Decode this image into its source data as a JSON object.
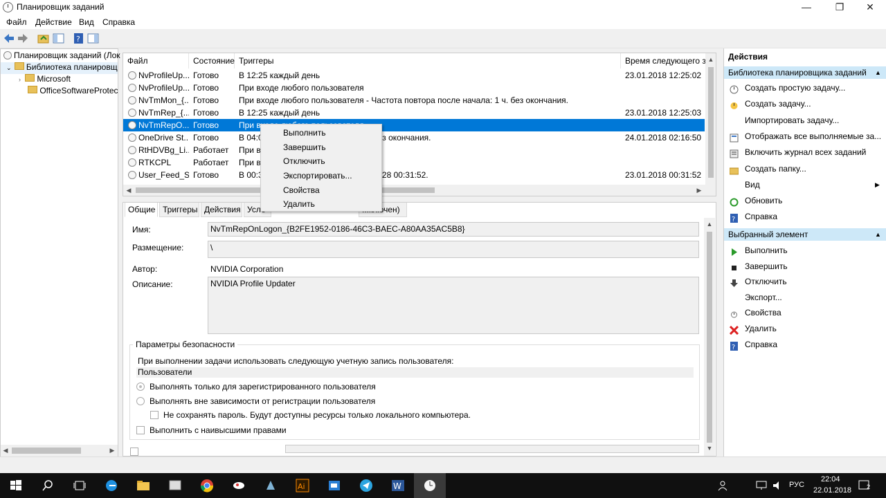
{
  "window": {
    "title": "Планировщик заданий",
    "controls": {
      "min": "—",
      "max": "❐",
      "close": "✕"
    }
  },
  "menu": [
    "Файл",
    "Действие",
    "Вид",
    "Справка"
  ],
  "tree": {
    "root": "Планировщик заданий (Лок",
    "library": "Библиотека планировщ",
    "children": [
      "Microsoft",
      "OfficeSoftwareProtect"
    ]
  },
  "tasks": {
    "columns": [
      "Файл",
      "Состояние",
      "Триггеры",
      "Время следующего за"
    ],
    "rows": [
      {
        "name": "NvProfileUp...",
        "state": "Готово",
        "trigger": "В 12:25 каждый день",
        "next": "23.01.2018 12:25:02"
      },
      {
        "name": "NvProfileUp...",
        "state": "Готово",
        "trigger": "При входе любого пользователя",
        "next": ""
      },
      {
        "name": "NvTmMon_{...",
        "state": "Готово",
        "trigger": "При входе любого пользователя - Частота повтора после начала: 1 ч. без окончания.",
        "next": ""
      },
      {
        "name": "NvTmRep_{...",
        "state": "Готово",
        "trigger": "В 12:25 каждый день",
        "next": "23.01.2018 12:25:03"
      },
      {
        "name": "NvTmRepO...",
        "state": "Готово",
        "trigger": "При входе любого пользователя",
        "next": ""
      },
      {
        "name": "OneDrive St...",
        "state": "Готово",
        "trigger": "В 04:00 ... осле начала: 1.00:00:00 без окончания.",
        "next": "24.01.2018 02:16:50"
      },
      {
        "name": "RtHDVBg_Li...",
        "state": "Работает",
        "trigger": "При в",
        "next": ""
      },
      {
        "name": "RTKCPL",
        "state": "Работает",
        "trigger": "При в",
        "next": ""
      },
      {
        "name": "User_Feed_S...",
        "state": "Готово",
        "trigger": "В 00:3 ... действия триггера: 23.01.2028 00:31:52.",
        "next": "23.01.2018 00:31:52"
      }
    ]
  },
  "context_menu": [
    "Выполнить",
    "Завершить",
    "Отключить",
    "Экспортировать...",
    "Свойства",
    "Удалить"
  ],
  "details": {
    "tabs": [
      "Общие",
      "Триггеры",
      "Действия",
      "Усло",
      "...ключен)"
    ],
    "name_label": "Имя:",
    "name_value": "NvTmRepOnLogon_{B2FE1952-0186-46C3-BAEC-A80AA35AC5B8}",
    "location_label": "Размещение:",
    "location_value": "\\",
    "author_label": "Автор:",
    "author_value": "NVIDIA Corporation",
    "desc_label": "Описание:",
    "desc_value": "NVIDIA Profile Updater",
    "security_title": "Параметры безопасности",
    "security_text": "При выполнении задачи использовать следующую учетную запись пользователя:",
    "users": "Пользователи",
    "opt1": "Выполнять только для зарегистрированного пользователя",
    "opt2": "Выполнять вне зависимости от регистрации пользователя",
    "opt3": "Не сохранять пароль. Будут доступны ресурсы только локального компьютера.",
    "opt4": "Выполнить с наивысшими правами"
  },
  "actions": {
    "header": "Действия",
    "section1": "Библиотека планировщика заданий",
    "items1": [
      "Создать простую задачу...",
      "Создать задачу...",
      "Импортировать задачу...",
      "Отображать все выполняемые за...",
      "Включить журнал всех заданий",
      "Создать папку...",
      "Вид",
      "Обновить",
      "Справка"
    ],
    "section2": "Выбранный элемент",
    "items2": [
      "Выполнить",
      "Завершить",
      "Отключить",
      "Экспорт...",
      "Свойства",
      "Удалить",
      "Справка"
    ]
  },
  "tray": {
    "lang": "РУС",
    "time": "22:04",
    "date": "22.01.2018",
    "notif": "2"
  }
}
